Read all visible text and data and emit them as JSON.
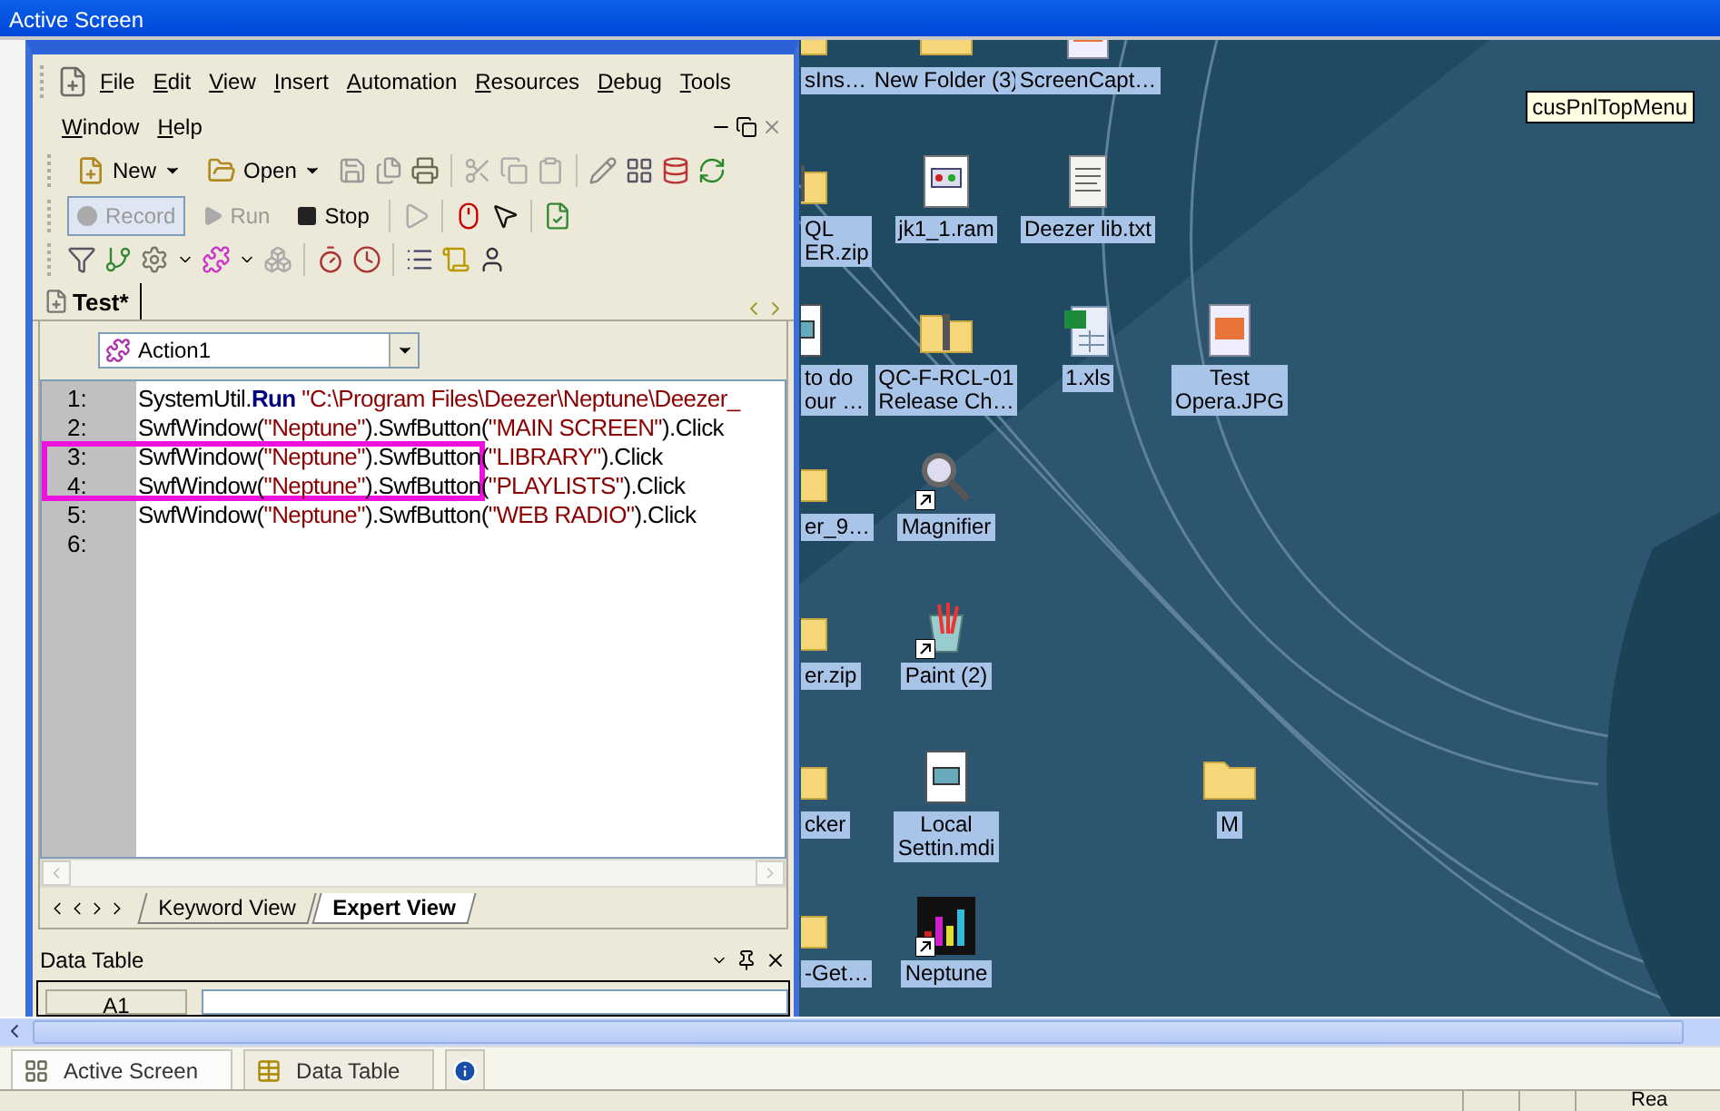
{
  "title_bar": {
    "title": "Active Screen"
  },
  "app_window": {
    "menu_rows": [
      [
        "File",
        "Edit",
        "View",
        "Insert",
        "Automation",
        "Resources",
        "Debug",
        "Tools"
      ],
      [
        "Window",
        "Help"
      ]
    ],
    "file_buttons": [
      {
        "label": "New",
        "dropdown": true
      },
      {
        "label": "Open",
        "dropdown": true
      }
    ],
    "run_controls": [
      {
        "label": "Record",
        "disabled": true,
        "pressed": true
      },
      {
        "label": "Run",
        "disabled": true,
        "pressed": false
      },
      {
        "label": "Stop",
        "disabled": false,
        "pressed": false
      }
    ],
    "document_tab": {
      "label": "Test*"
    },
    "action_select": {
      "value": "Action1"
    },
    "code_lines": [
      {
        "number": "1:",
        "tokens": [
          {
            "kind": "plain",
            "text": "SystemUtil."
          },
          {
            "kind": "keyword",
            "text": "Run"
          },
          {
            "kind": "string",
            "text": " \"C:\\Program Files\\Deezer\\Neptune\\Deezer_"
          }
        ]
      },
      {
        "number": "2:",
        "tokens": [
          {
            "kind": "plain",
            "text": "SwfWindow("
          },
          {
            "kind": "string",
            "text": "\"Neptune\""
          },
          {
            "kind": "plain",
            "text": ").SwfButton("
          },
          {
            "kind": "string",
            "text": "\"MAIN SCREEN\""
          },
          {
            "kind": "plain",
            "text": ").Click"
          }
        ]
      },
      {
        "number": "3:",
        "tokens": [
          {
            "kind": "plain",
            "text": "SwfWindow("
          },
          {
            "kind": "string",
            "text": "\"Neptune\""
          },
          {
            "kind": "plain",
            "text": ").SwfButton("
          },
          {
            "kind": "string",
            "text": "\"LIBRARY\""
          },
          {
            "kind": "plain",
            "text": ").Click"
          }
        ]
      },
      {
        "number": "4:",
        "tokens": [
          {
            "kind": "plain",
            "text": "SwfWindow("
          },
          {
            "kind": "string",
            "text": "\"Neptune\""
          },
          {
            "kind": "plain",
            "text": ").SwfButton("
          },
          {
            "kind": "string",
            "text": "\"PLAYLISTS\""
          },
          {
            "kind": "plain",
            "text": ").Click"
          }
        ]
      },
      {
        "number": "5:",
        "tokens": [
          {
            "kind": "plain",
            "text": "SwfWindow("
          },
          {
            "kind": "string",
            "text": "\"Neptune\""
          },
          {
            "kind": "plain",
            "text": ").SwfButton("
          },
          {
            "kind": "string",
            "text": "\"WEB RADIO\""
          },
          {
            "kind": "plain",
            "text": ").Click"
          }
        ]
      },
      {
        "number": "6:"
      }
    ],
    "view_tabs": [
      {
        "label": "Keyword View",
        "selected": false
      },
      {
        "label": "Expert View",
        "selected": true
      }
    ],
    "data_table": {
      "title": "Data Table",
      "cell": "A1"
    }
  },
  "desktop": {
    "rows": [
      {
        "icons": [
          {
            "kind": "folder",
            "label": "sIns…"
          },
          {
            "kind": "folder",
            "label": "New Folder (3)"
          },
          {
            "kind": "image",
            "label": "ScreenCapt…"
          }
        ]
      },
      {
        "icons": [
          {
            "kind": "zip",
            "label": "QL\nER.zip"
          },
          {
            "kind": "media",
            "label": "jk1_1.ram"
          },
          {
            "kind": "text",
            "label": "Deezer lib.txt"
          }
        ]
      },
      {
        "icons": [
          {
            "kind": "file",
            "label": "to do\nour …"
          },
          {
            "kind": "zip",
            "label": "QC-F-RCL-01\nRelease Ch…"
          },
          {
            "kind": "sheet",
            "label": "1.xls"
          },
          {
            "kind": "image",
            "label": "Test\nOpera.JPG"
          }
        ]
      },
      {
        "icons": [
          {
            "kind": "folder",
            "label": "er_9…"
          },
          {
            "kind": "magnifier",
            "label": "Magnifier",
            "shortcut": true
          }
        ]
      },
      {
        "icons": [
          {
            "kind": "folder",
            "label": "er.zip"
          },
          {
            "kind": "paint",
            "label": "Paint (2)",
            "shortcut": true
          }
        ]
      },
      {
        "icons": [
          {
            "kind": "folder",
            "label": "cker"
          },
          {
            "kind": "file",
            "label": "Local\nSettin.mdi"
          },
          {
            "kind": "empty"
          },
          {
            "kind": "folder",
            "label": "M"
          }
        ]
      },
      {
        "icons": [
          {
            "kind": "folder",
            "label": "-Get…"
          },
          {
            "kind": "equalizer",
            "label": "Neptune",
            "shortcut": true
          }
        ]
      }
    ],
    "tooltip": "cusPnlTopMenu"
  },
  "bottom_tabs": [
    {
      "label": "Active Screen",
      "selected": true
    },
    {
      "label": "Data Table",
      "selected": false
    }
  ],
  "status_bar": {
    "text": "Rea"
  }
}
